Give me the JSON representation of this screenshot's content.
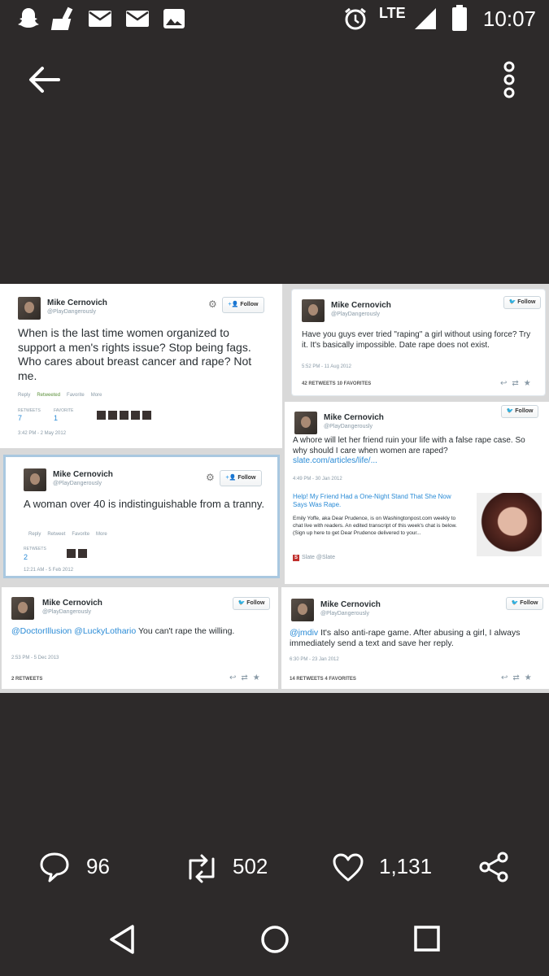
{
  "status": {
    "time": "10:07",
    "network": "LTE"
  },
  "actions": {
    "replies": "96",
    "retweets": "502",
    "likes": "1,131"
  },
  "tweets": [
    {
      "name": "Mike Cernovich",
      "handle": "@PlayDangerously",
      "follow": "Follow",
      "text": "When is the last time women organized to support a men's rights issue? Stop being fags. Who cares about breast cancer and rape? Not me.",
      "actions": [
        "Reply",
        "Retweeted",
        "Favorite",
        "More"
      ],
      "retweets_label": "RETWEETS",
      "retweets": "7",
      "favorites_label": "FAVORITE",
      "favorites": "1",
      "time": "3:42 PM - 2 May 2012"
    },
    {
      "name": "Mike Cernovich",
      "handle": "@PlayDangerously",
      "follow": "Follow",
      "text": "Have you guys ever tried \"raping\" a girl without using force? Try it. It's basically impossible. Date rape does not exist.",
      "time": "5:52 PM - 11 Aug 2012",
      "stats": "42 RETWEETS  10 FAVORITES"
    },
    {
      "name": "Mike Cernovich",
      "handle": "@PlayDangerously",
      "follow": "Follow",
      "text": "A whore will let her friend ruin your life with a false rape case. So why should I care when women are raped?",
      "link": "slate.com/articles/life/...",
      "time": "4:49 PM - 30 Jan 2012",
      "card_title": "Help! My Friend Had a One-Night Stand That She Now Says Was Rape.",
      "card_desc": "Emily Yoffe, aka Dear Prudence, is on Washingtonpost.com weekly to chat live with readers. An edited transcript of this week's chat is below. (Sign up here to get Dear Prudence delivered to your...",
      "card_source": "Slate @Slate",
      "card_logo": "S"
    },
    {
      "name": "Mike Cernovich",
      "handle": "@PlayDangerously",
      "follow": "Follow",
      "text": "A woman over 40 is indistinguishable from a tranny.",
      "actions": [
        "Reply",
        "Retweet",
        "Favorite",
        "More"
      ],
      "retweets_label": "RETWEETS",
      "retweets": "2",
      "time": "12:21 AM - 5 Feb 2012"
    },
    {
      "name": "Mike Cernovich",
      "handle": "@PlayDangerously",
      "follow": "Follow",
      "mention": "@DoctorIllusion @LuckyLothario",
      "text": " You can't rape the willing.",
      "time": "2:53 PM - 5 Dec 2013",
      "stats": "2 RETWEETS"
    },
    {
      "name": "Mike Cernovich",
      "handle": "@PlayDangerously",
      "follow": "Follow",
      "mention": "@jmdiv",
      "text": " It's also anti-rape game. After abusing a girl, I always immediately send a text and save her reply.",
      "time": "6:30 PM - 23 Jan 2012",
      "stats": "14 RETWEETS  4 FAVORITES"
    }
  ]
}
